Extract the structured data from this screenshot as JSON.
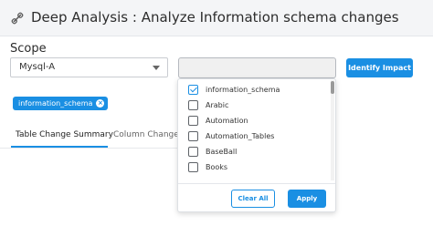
{
  "header": {
    "title": "Deep Analysis : Analyze Information schema changes",
    "icon": "link-icon"
  },
  "scope": {
    "label": "Scope",
    "db_select_value": "Mysql-A",
    "search_value": ""
  },
  "identify_button": "Identify Impact",
  "chip": {
    "label": "information_schema"
  },
  "tabs": [
    {
      "label": "Table Change Summary",
      "active": true
    },
    {
      "label": "Column Change D",
      "active": false
    }
  ],
  "dropdown": {
    "options": [
      {
        "label": "information_schema",
        "checked": true
      },
      {
        "label": "Arabic",
        "checked": false
      },
      {
        "label": "Automation",
        "checked": false
      },
      {
        "label": "Automation_Tables",
        "checked": false
      },
      {
        "label": "BaseBall",
        "checked": false
      },
      {
        "label": "Books",
        "checked": false
      }
    ],
    "clear_label": "Clear All",
    "apply_label": "Apply"
  },
  "colors": {
    "accent": "#1a8fe3",
    "header_bg": "#f4f5f7"
  }
}
